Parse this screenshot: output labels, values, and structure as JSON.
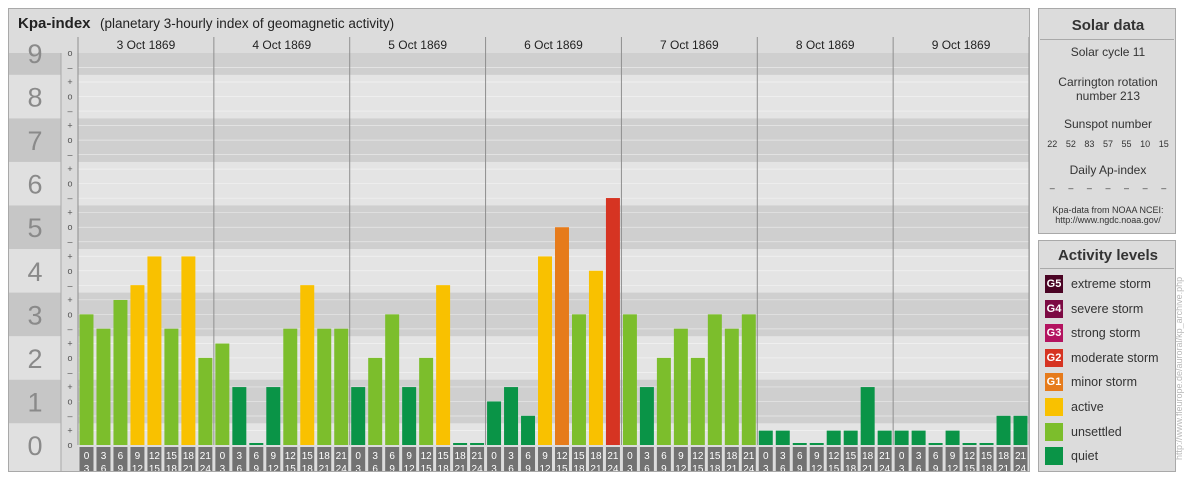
{
  "header": {
    "title": "Kpa-index",
    "subtitle": "(planetary 3-hourly index of geomagnetic activity)"
  },
  "chart_data": {
    "type": "bar",
    "ylim": [
      0,
      9
    ],
    "y_ticks": [
      "0",
      "1",
      "2",
      "3",
      "4",
      "5",
      "6",
      "7",
      "8",
      "9"
    ],
    "sub_ticks": [
      "o",
      "+",
      "–"
    ],
    "interval_top_labels": [
      "0",
      "3",
      "6",
      "9",
      "12",
      "15",
      "18",
      "21"
    ],
    "interval_bottom_labels": [
      "3",
      "6",
      "9",
      "12",
      "15",
      "18",
      "21",
      "24"
    ],
    "days": [
      {
        "date": "3 Oct 1869",
        "kp": [
          3.0,
          2.67,
          3.33,
          3.67,
          4.33,
          2.67,
          4.33,
          2.0
        ]
      },
      {
        "date": "4 Oct 1869",
        "kp": [
          2.33,
          1.33,
          0.0,
          1.33,
          2.67,
          3.67,
          2.67,
          2.67
        ]
      },
      {
        "date": "5 Oct 1869",
        "kp": [
          1.33,
          2.0,
          3.0,
          1.33,
          2.0,
          3.67,
          0.0,
          0.0
        ]
      },
      {
        "date": "6 Oct 1869",
        "kp": [
          1.0,
          1.33,
          0.67,
          4.33,
          5.0,
          3.0,
          4.0,
          5.67
        ]
      },
      {
        "date": "7 Oct 1869",
        "kp": [
          3.0,
          1.33,
          2.0,
          2.67,
          2.0,
          3.0,
          2.67,
          3.0
        ]
      },
      {
        "date": "8 Oct 1869",
        "kp": [
          0.33,
          0.33,
          0.0,
          0.0,
          0.33,
          0.33,
          1.33,
          0.33
        ]
      },
      {
        "date": "9 Oct 1869",
        "kp": [
          0.33,
          0.33,
          0.0,
          0.33,
          0.0,
          0.0,
          0.67,
          0.67
        ]
      }
    ],
    "level_colors": {
      "quiet": "#0a9447",
      "unsettled": "#7cbe2c",
      "active": "#f9c100",
      "G1": "#e67b1b",
      "G2": "#d63422",
      "G3": "#b3135f",
      "G4": "#7c0a43",
      "G5": "#4a0424"
    }
  },
  "solar_data": {
    "title": "Solar data",
    "solar_cycle": "Solar cycle 11",
    "carrington_line1": "Carrington rotation",
    "carrington_line2": "number 213",
    "sunspot_title": "Sunspot number",
    "sunspot_values": [
      "22",
      "52",
      "83",
      "57",
      "55",
      "10",
      "15"
    ],
    "ap_title": "Daily Ap-index",
    "ap_values": [
      "–",
      "–",
      "–",
      "–",
      "–",
      "–",
      "–"
    ],
    "source_line1": "Kpa-data from NOAA NCEI:",
    "source_line2": "http://www.ngdc.noaa.gov/"
  },
  "activity_levels": {
    "title": "Activity levels",
    "items": [
      {
        "code": "G5",
        "label": "extreme storm",
        "color": "#4a0424"
      },
      {
        "code": "G4",
        "label": "severe storm",
        "color": "#7c0a43"
      },
      {
        "code": "G3",
        "label": "strong storm",
        "color": "#b3135f"
      },
      {
        "code": "G2",
        "label": "moderate storm",
        "color": "#d63422"
      },
      {
        "code": "G1",
        "label": "minor storm",
        "color": "#e67b1b"
      },
      {
        "code": "",
        "label": "active",
        "color": "#f9c100"
      },
      {
        "code": "",
        "label": "unsettled",
        "color": "#7cbe2c"
      },
      {
        "code": "",
        "label": "quiet",
        "color": "#0a9447"
      }
    ]
  },
  "watermark": "http://www.fleurope.de/auroral/kp_archive.php"
}
